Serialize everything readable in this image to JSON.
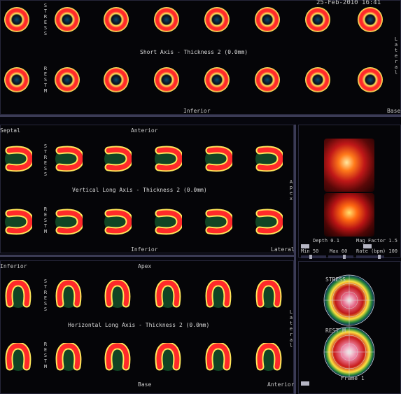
{
  "header": {
    "datetime": "25-Feb-2010 16:41"
  },
  "short_axis": {
    "caption": "Short Axis - Thickness 2 (0.0mm)",
    "stress_label": "STRESS",
    "rest_label": "REST M",
    "bottom_label": "Inferior",
    "right_label": "Lateral",
    "corner_label": "Base"
  },
  "vertical_long_axis": {
    "caption": "Vertical Long Axis - Thickness 2 (0.0mm)",
    "stress_label": "STRESS",
    "rest_label": "REST M",
    "top_label": "Anterior",
    "left_label": "Septal",
    "bottom_label": "Inferior",
    "right_label": "Apex",
    "corner_label": "Lateral"
  },
  "horizontal_long_axis": {
    "caption": "Horizontal Long Axis - Thickness 2 (0.0mm)",
    "stress_label": "STRESS",
    "rest_label": "REST M",
    "top_label": "Apex",
    "left_label": "Inferior",
    "bottom_label": "Base",
    "right_label": "Lateral",
    "corner_label": "Anterior"
  },
  "controls": {
    "depth_label": "Depth 0.1",
    "mag_label": "Mag Factor 1.5",
    "min_label": "Min 50",
    "max_label": "Max 60",
    "rate_label": "Rate (bpm) 100"
  },
  "polar_maps": {
    "stress_label": "STRESS",
    "rest_label": "REST M",
    "frame_label": "Frame 1"
  },
  "colors": {
    "myocardium_high": "#ff2a2a",
    "myocardium_mid": "#ffe85a",
    "cavity": "#0a4a6a",
    "background_tissue": "#1c7a3c"
  }
}
